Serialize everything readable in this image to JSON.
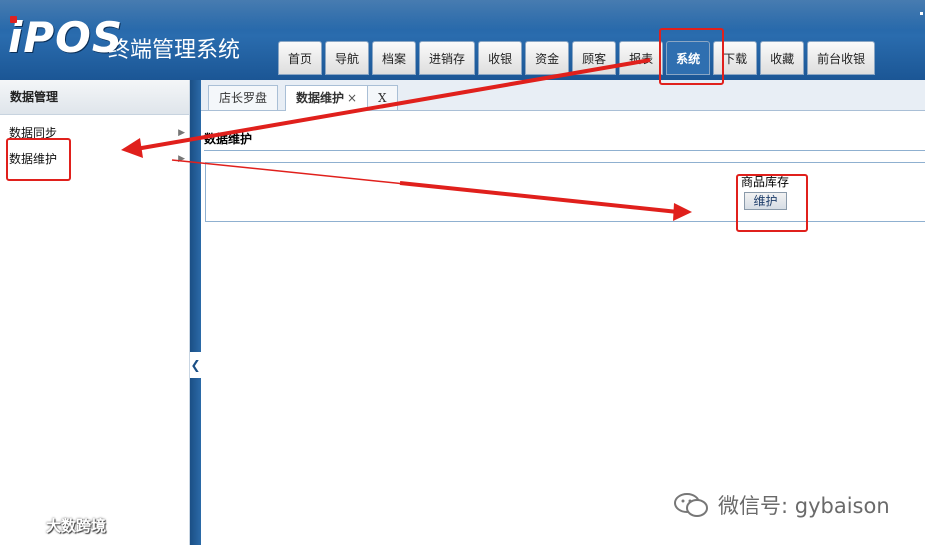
{
  "header": {
    "logo": "iPOS",
    "system_name": "终端管理系统"
  },
  "nav": {
    "tabs": [
      "首页",
      "导航",
      "档案",
      "进销存",
      "收银",
      "资金",
      "顾客",
      "报表",
      "系统",
      "下载",
      "收藏",
      "前台收银"
    ],
    "active": "系统"
  },
  "sidebar": {
    "title": "数据管理",
    "items": [
      {
        "label": "数据同步",
        "arrow": "▶"
      },
      {
        "label": "数据维护",
        "arrow": "▶"
      }
    ],
    "collapse_glyph": "❮"
  },
  "tabs": [
    {
      "label": "店长罗盘"
    },
    {
      "label": "数据维护",
      "close": "×",
      "active": true
    },
    {
      "label": "X"
    }
  ],
  "content": {
    "section_title": "数据维护",
    "stock_label": "商品库存",
    "maintain_button": "维护"
  },
  "annotation": {
    "color": "#e0201c"
  },
  "watermarks": {
    "right_text": "微信号: gybaison",
    "left_text": "大数跨境"
  }
}
